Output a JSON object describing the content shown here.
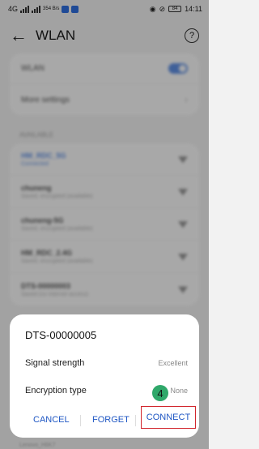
{
  "status": {
    "network_label": "4G",
    "speed": "354 B/s",
    "battery": "84",
    "time": "14:11"
  },
  "appbar": {
    "title": "WLAN"
  },
  "settings": {
    "wlan_label": "WLAN",
    "more_label": "More settings"
  },
  "section_label": "AVAILABLE",
  "networks": [
    {
      "name": "HM_RDC_5G",
      "status": "Connected"
    },
    {
      "name": "chuneng",
      "status": "Saved, encrypted (available)"
    },
    {
      "name": "chuneng-5G",
      "status": "Saved, encrypted (available)"
    },
    {
      "name": "HM_RDC_2.4G",
      "status": "Saved, encrypted (available)"
    },
    {
      "name": "DTS-00000003",
      "status": "Saved (no internet access)"
    }
  ],
  "dialog": {
    "title": "DTS-00000005",
    "signal_label": "Signal strength",
    "signal_value": "Excellent",
    "encryption_label": "Encryption type",
    "encryption_value": "None",
    "step_badge": "4",
    "cancel": "CANCEL",
    "forget": "FORGET",
    "connect": "CONNECT"
  },
  "peek_text": "Lenovo_H6K7"
}
